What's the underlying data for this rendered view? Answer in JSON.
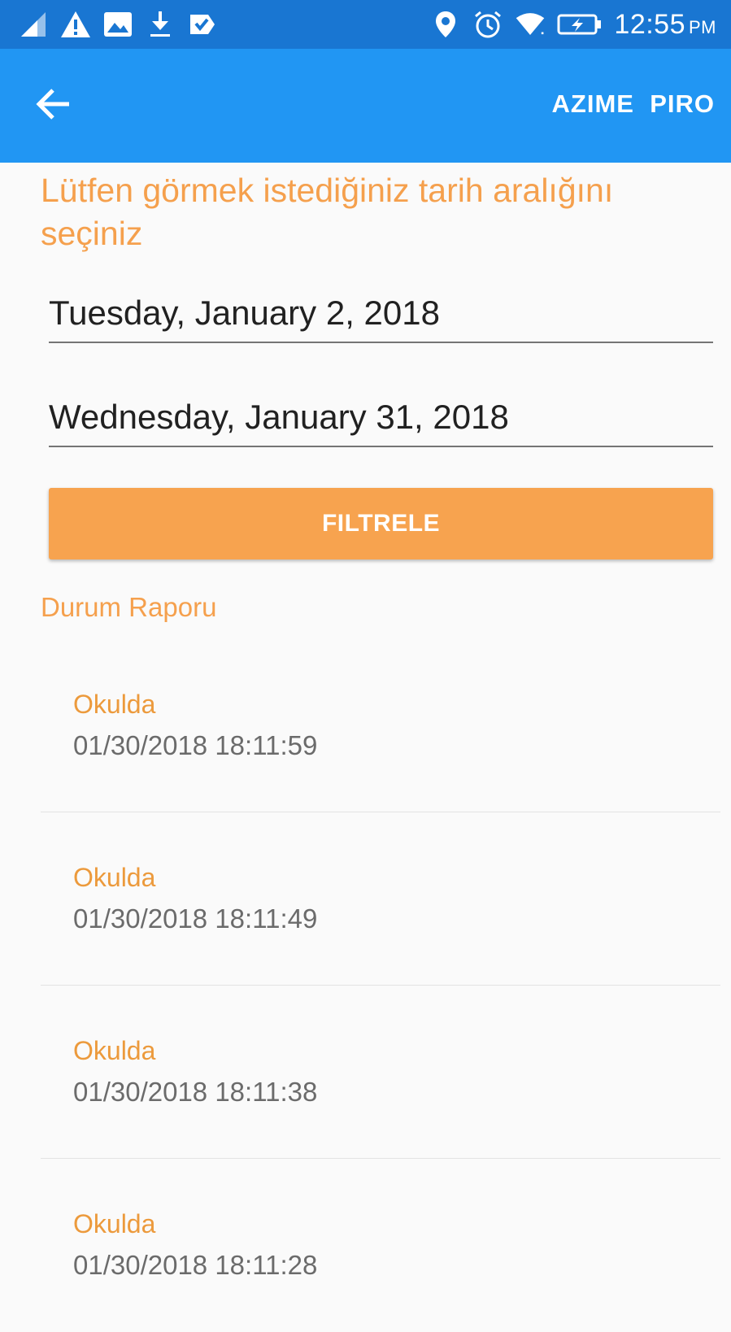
{
  "status_bar": {
    "time": "12:55",
    "ampm": "PM",
    "left_icons": [
      "signal-icon",
      "warning-icon",
      "image-icon",
      "download-icon",
      "task-check-icon"
    ],
    "right_icons": [
      "location-icon",
      "alarm-icon",
      "wifi-icon",
      "battery-charging-icon"
    ]
  },
  "app_bar": {
    "user_name": "AZIME  PIRO",
    "back_icon": "back-arrow-icon",
    "color": "#2196f3"
  },
  "form": {
    "prompt": "Lütfen görmek istediğiniz tarih aralığını seçiniz",
    "start_date": "Tuesday, January 2, 2018",
    "end_date": "Wednesday, January 31, 2018",
    "filter_label": "FILTRELE",
    "accent_color": "#f7a34f"
  },
  "report": {
    "title": "Durum Raporu",
    "items": [
      {
        "status": "Okulda",
        "timestamp": "01/30/2018 18:11:59"
      },
      {
        "status": "Okulda",
        "timestamp": "01/30/2018 18:11:49"
      },
      {
        "status": "Okulda",
        "timestamp": "01/30/2018 18:11:38"
      },
      {
        "status": "Okulda",
        "timestamp": "01/30/2018 18:11:28"
      }
    ]
  }
}
